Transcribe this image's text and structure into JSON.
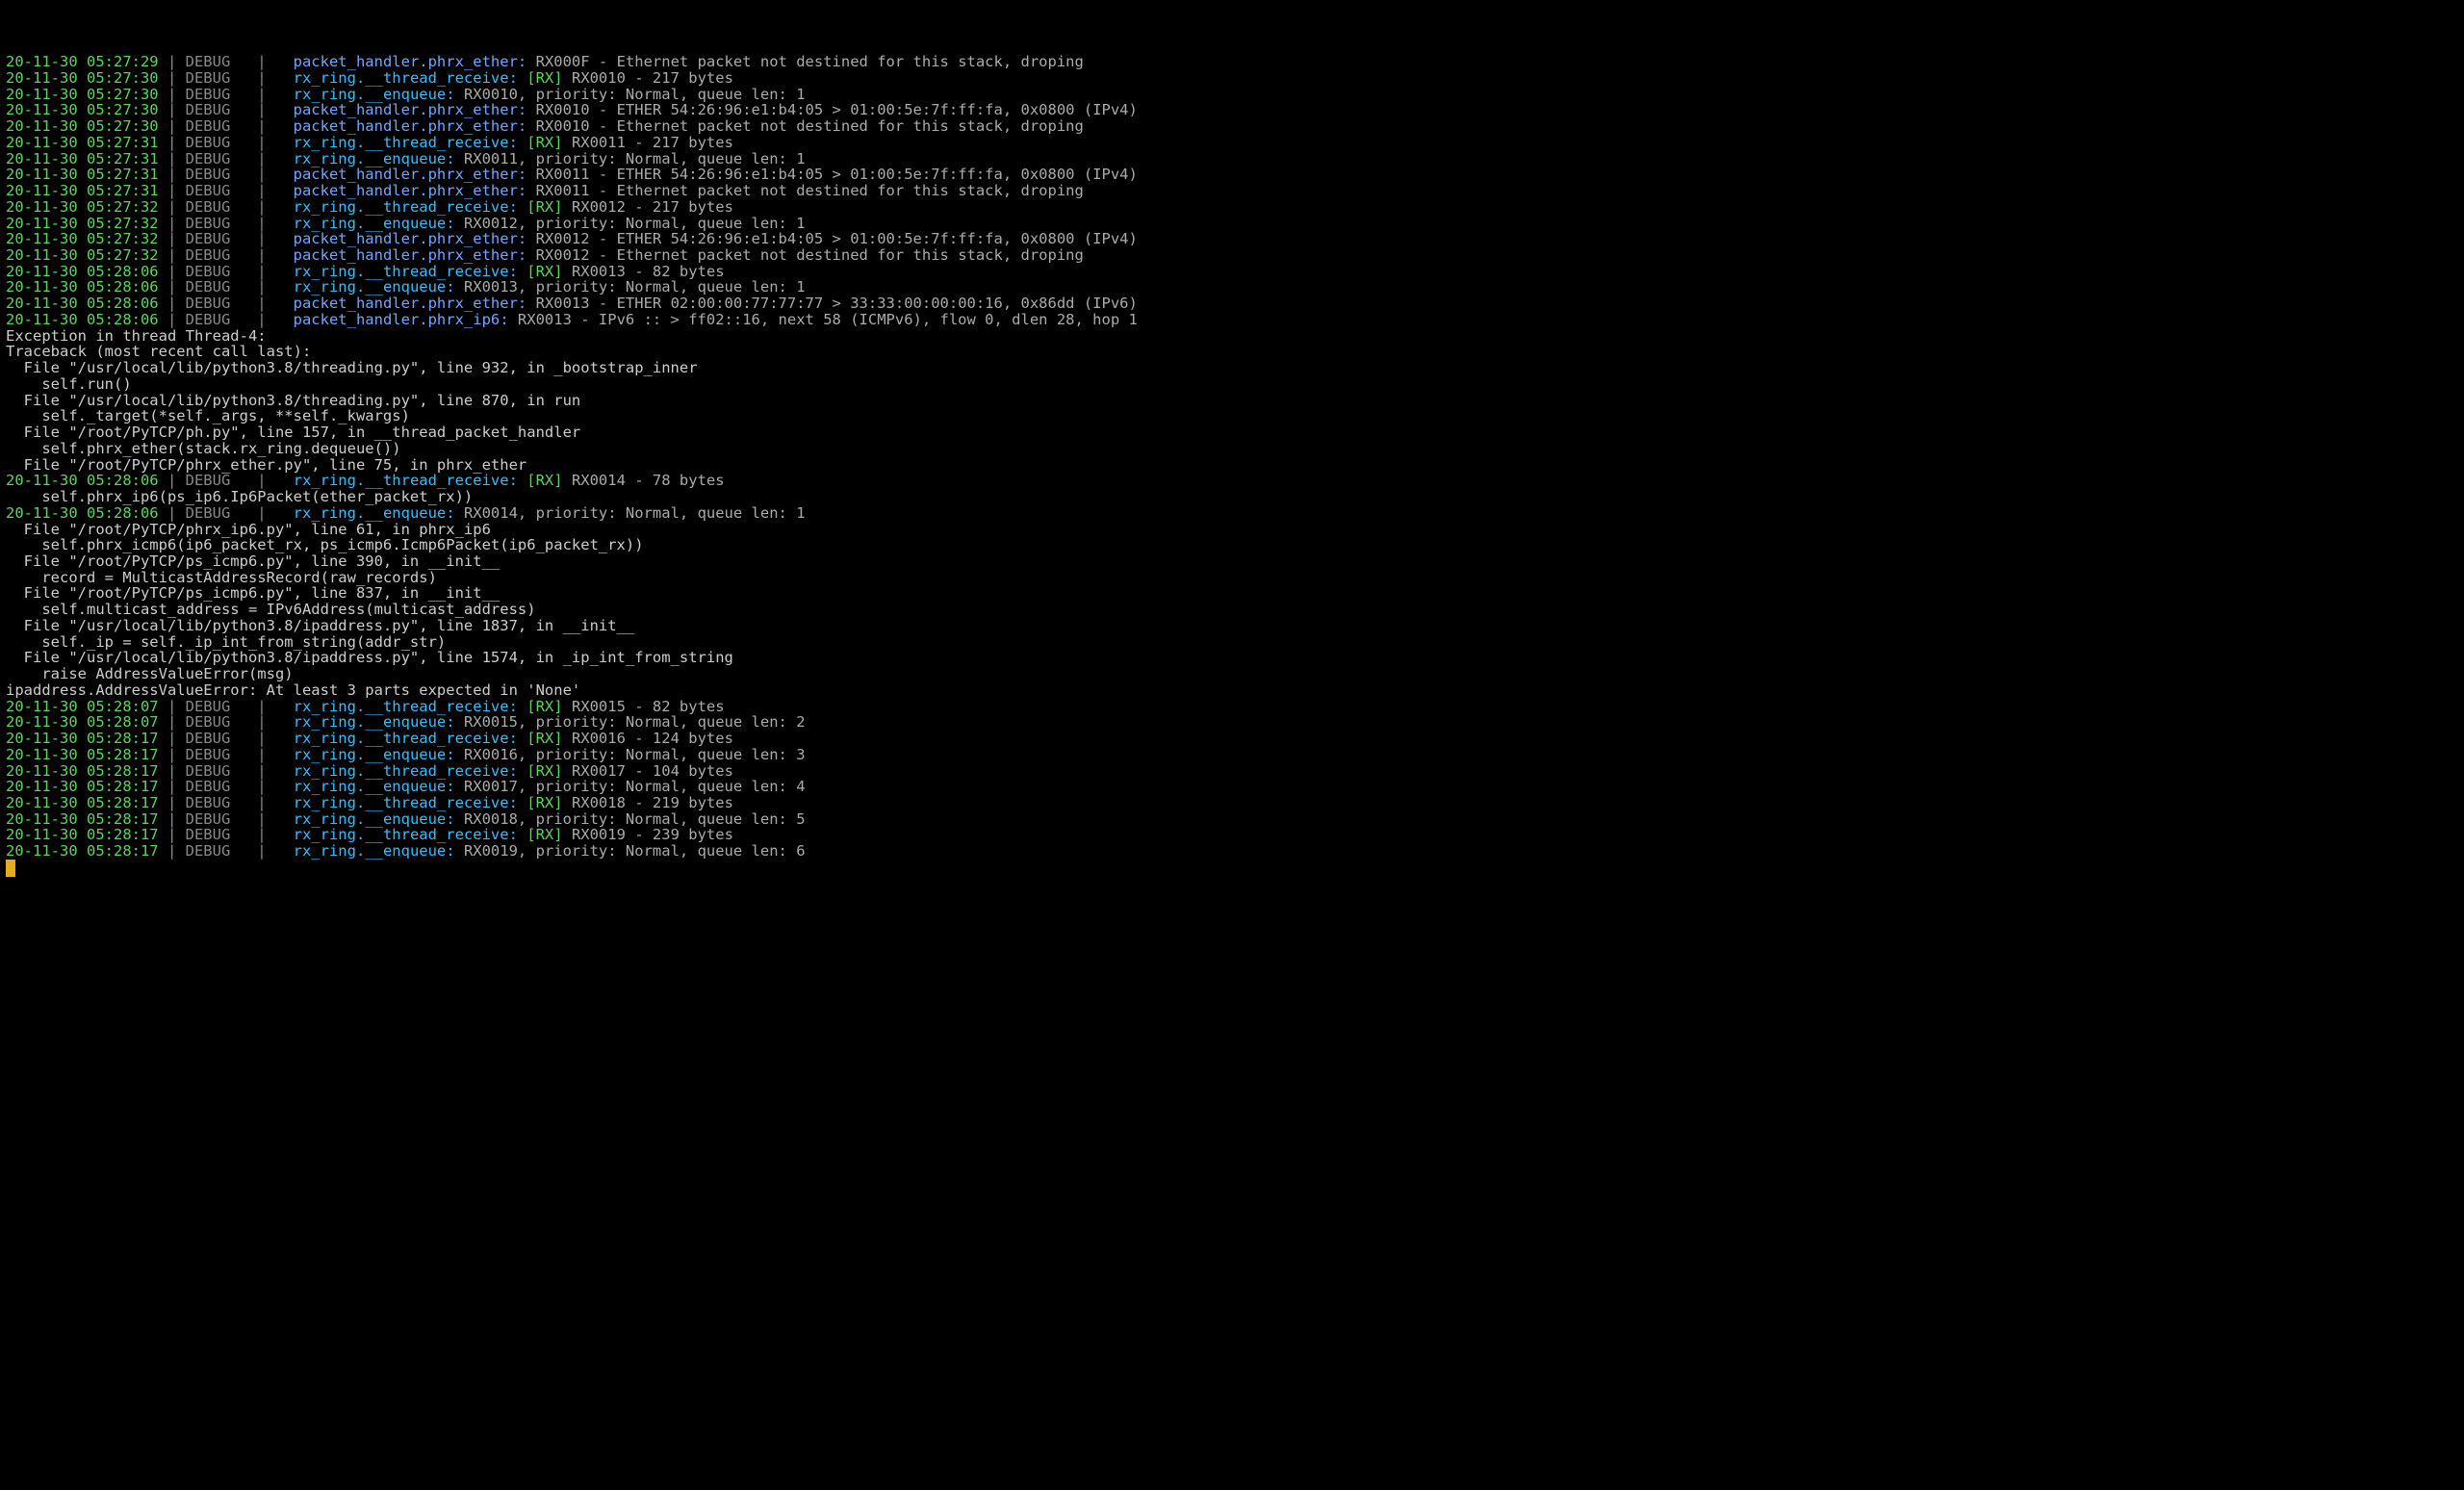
{
  "lines": [
    {
      "type": "log",
      "ts": "20-11-30 05:27:29",
      "lvl": "DEBUG",
      "mod": "packet_handler.phrx_ether:",
      "modClass": "pmod",
      "rx": "",
      "msg": "RX000F - Ethernet packet not destined for this stack, droping"
    },
    {
      "type": "log",
      "ts": "20-11-30 05:27:30",
      "lvl": "DEBUG",
      "mod": "rx_ring.__thread_receive:",
      "modClass": "mod",
      "rx": "[RX] ",
      "msg": "RX0010 - 217 bytes"
    },
    {
      "type": "log",
      "ts": "20-11-30 05:27:30",
      "lvl": "DEBUG",
      "mod": "rx_ring.__enqueue:",
      "modClass": "mod",
      "rx": "",
      "msg": "RX0010, priority: Normal, queue len: 1"
    },
    {
      "type": "log",
      "ts": "20-11-30 05:27:30",
      "lvl": "DEBUG",
      "mod": "packet_handler.phrx_ether:",
      "modClass": "pmod",
      "rx": "",
      "msg": "RX0010 - ETHER 54:26:96:e1:b4:05 > 01:00:5e:7f:ff:fa, 0x0800 (IPv4)"
    },
    {
      "type": "log",
      "ts": "20-11-30 05:27:30",
      "lvl": "DEBUG",
      "mod": "packet_handler.phrx_ether:",
      "modClass": "pmod",
      "rx": "",
      "msg": "RX0010 - Ethernet packet not destined for this stack, droping"
    },
    {
      "type": "log",
      "ts": "20-11-30 05:27:31",
      "lvl": "DEBUG",
      "mod": "rx_ring.__thread_receive:",
      "modClass": "mod",
      "rx": "[RX] ",
      "msg": "RX0011 - 217 bytes"
    },
    {
      "type": "log",
      "ts": "20-11-30 05:27:31",
      "lvl": "DEBUG",
      "mod": "rx_ring.__enqueue:",
      "modClass": "mod",
      "rx": "",
      "msg": "RX0011, priority: Normal, queue len: 1"
    },
    {
      "type": "log",
      "ts": "20-11-30 05:27:31",
      "lvl": "DEBUG",
      "mod": "packet_handler.phrx_ether:",
      "modClass": "pmod",
      "rx": "",
      "msg": "RX0011 - ETHER 54:26:96:e1:b4:05 > 01:00:5e:7f:ff:fa, 0x0800 (IPv4)"
    },
    {
      "type": "log",
      "ts": "20-11-30 05:27:31",
      "lvl": "DEBUG",
      "mod": "packet_handler.phrx_ether:",
      "modClass": "pmod",
      "rx": "",
      "msg": "RX0011 - Ethernet packet not destined for this stack, droping"
    },
    {
      "type": "log",
      "ts": "20-11-30 05:27:32",
      "lvl": "DEBUG",
      "mod": "rx_ring.__thread_receive:",
      "modClass": "mod",
      "rx": "[RX] ",
      "msg": "RX0012 - 217 bytes"
    },
    {
      "type": "log",
      "ts": "20-11-30 05:27:32",
      "lvl": "DEBUG",
      "mod": "rx_ring.__enqueue:",
      "modClass": "mod",
      "rx": "",
      "msg": "RX0012, priority: Normal, queue len: 1"
    },
    {
      "type": "log",
      "ts": "20-11-30 05:27:32",
      "lvl": "DEBUG",
      "mod": "packet_handler.phrx_ether:",
      "modClass": "pmod",
      "rx": "",
      "msg": "RX0012 - ETHER 54:26:96:e1:b4:05 > 01:00:5e:7f:ff:fa, 0x0800 (IPv4)"
    },
    {
      "type": "log",
      "ts": "20-11-30 05:27:32",
      "lvl": "DEBUG",
      "mod": "packet_handler.phrx_ether:",
      "modClass": "pmod",
      "rx": "",
      "msg": "RX0012 - Ethernet packet not destined for this stack, droping"
    },
    {
      "type": "log",
      "ts": "20-11-30 05:28:06",
      "lvl": "DEBUG",
      "mod": "rx_ring.__thread_receive:",
      "modClass": "mod",
      "rx": "[RX] ",
      "msg": "RX0013 - 82 bytes"
    },
    {
      "type": "log",
      "ts": "20-11-30 05:28:06",
      "lvl": "DEBUG",
      "mod": "rx_ring.__enqueue:",
      "modClass": "mod",
      "rx": "",
      "msg": "RX0013, priority: Normal, queue len: 1"
    },
    {
      "type": "log",
      "ts": "20-11-30 05:28:06",
      "lvl": "DEBUG",
      "mod": "packet_handler.phrx_ether:",
      "modClass": "pmod",
      "rx": "",
      "msg": "RX0013 - ETHER 02:00:00:77:77:77 > 33:33:00:00:00:16, 0x86dd (IPv6)"
    },
    {
      "type": "log",
      "ts": "20-11-30 05:28:06",
      "lvl": "DEBUG",
      "mod": "packet_handler.phrx_ip6:",
      "modClass": "pmod",
      "rx": "",
      "msg": "RX0013 - IPv6 :: > ff02::16, next 58 (ICMPv6), flow 0, dlen 28, hop 1"
    },
    {
      "type": "trace",
      "text": "Exception in thread Thread-4:"
    },
    {
      "type": "trace",
      "text": "Traceback (most recent call last):"
    },
    {
      "type": "trace",
      "text": "  File \"/usr/local/lib/python3.8/threading.py\", line 932, in _bootstrap_inner"
    },
    {
      "type": "trace",
      "text": "    self.run()"
    },
    {
      "type": "trace",
      "text": "  File \"/usr/local/lib/python3.8/threading.py\", line 870, in run"
    },
    {
      "type": "trace",
      "text": "    self._target(*self._args, **self._kwargs)"
    },
    {
      "type": "trace",
      "text": "  File \"/root/PyTCP/ph.py\", line 157, in __thread_packet_handler"
    },
    {
      "type": "trace",
      "text": "    self.phrx_ether(stack.rx_ring.dequeue())"
    },
    {
      "type": "trace",
      "text": "  File \"/root/PyTCP/phrx_ether.py\", line 75, in phrx_ether"
    },
    {
      "type": "log",
      "ts": "20-11-30 05:28:06",
      "lvl": "DEBUG",
      "mod": "rx_ring.__thread_receive:",
      "modClass": "mod",
      "rx": "[RX] ",
      "msg": "RX0014 - 78 bytes"
    },
    {
      "type": "trace",
      "text": "    self.phrx_ip6(ps_ip6.Ip6Packet(ether_packet_rx))"
    },
    {
      "type": "log",
      "ts": "20-11-30 05:28:06",
      "lvl": "DEBUG",
      "mod": "rx_ring.__enqueue:",
      "modClass": "mod",
      "rx": "",
      "msg": "RX0014, priority: Normal, queue len: 1"
    },
    {
      "type": "trace",
      "text": "  File \"/root/PyTCP/phrx_ip6.py\", line 61, in phrx_ip6"
    },
    {
      "type": "trace",
      "text": "    self.phrx_icmp6(ip6_packet_rx, ps_icmp6.Icmp6Packet(ip6_packet_rx))"
    },
    {
      "type": "trace",
      "text": "  File \"/root/PyTCP/ps_icmp6.py\", line 390, in __init__"
    },
    {
      "type": "trace",
      "text": "    record = MulticastAddressRecord(raw_records)"
    },
    {
      "type": "trace",
      "text": "  File \"/root/PyTCP/ps_icmp6.py\", line 837, in __init__"
    },
    {
      "type": "trace",
      "text": "    self.multicast_address = IPv6Address(multicast_address)"
    },
    {
      "type": "trace",
      "text": "  File \"/usr/local/lib/python3.8/ipaddress.py\", line 1837, in __init__"
    },
    {
      "type": "trace",
      "text": "    self._ip = self._ip_int_from_string(addr_str)"
    },
    {
      "type": "trace",
      "text": "  File \"/usr/local/lib/python3.8/ipaddress.py\", line 1574, in _ip_int_from_string"
    },
    {
      "type": "trace",
      "text": "    raise AddressValueError(msg)"
    },
    {
      "type": "trace",
      "text": "ipaddress.AddressValueError: At least 3 parts expected in 'None'"
    },
    {
      "type": "log",
      "ts": "20-11-30 05:28:07",
      "lvl": "DEBUG",
      "mod": "rx_ring.__thread_receive:",
      "modClass": "mod",
      "rx": "[RX] ",
      "msg": "RX0015 - 82 bytes"
    },
    {
      "type": "log",
      "ts": "20-11-30 05:28:07",
      "lvl": "DEBUG",
      "mod": "rx_ring.__enqueue:",
      "modClass": "mod",
      "rx": "",
      "msg": "RX0015, priority: Normal, queue len: 2"
    },
    {
      "type": "log",
      "ts": "20-11-30 05:28:17",
      "lvl": "DEBUG",
      "mod": "rx_ring.__thread_receive:",
      "modClass": "mod",
      "rx": "[RX] ",
      "msg": "RX0016 - 124 bytes"
    },
    {
      "type": "log",
      "ts": "20-11-30 05:28:17",
      "lvl": "DEBUG",
      "mod": "rx_ring.__enqueue:",
      "modClass": "mod",
      "rx": "",
      "msg": "RX0016, priority: Normal, queue len: 3"
    },
    {
      "type": "log",
      "ts": "20-11-30 05:28:17",
      "lvl": "DEBUG",
      "mod": "rx_ring.__thread_receive:",
      "modClass": "mod",
      "rx": "[RX] ",
      "msg": "RX0017 - 104 bytes"
    },
    {
      "type": "log",
      "ts": "20-11-30 05:28:17",
      "lvl": "DEBUG",
      "mod": "rx_ring.__enqueue:",
      "modClass": "mod",
      "rx": "",
      "msg": "RX0017, priority: Normal, queue len: 4"
    },
    {
      "type": "log",
      "ts": "20-11-30 05:28:17",
      "lvl": "DEBUG",
      "mod": "rx_ring.__thread_receive:",
      "modClass": "mod",
      "rx": "[RX] ",
      "msg": "RX0018 - 219 bytes"
    },
    {
      "type": "log",
      "ts": "20-11-30 05:28:17",
      "lvl": "DEBUG",
      "mod": "rx_ring.__enqueue:",
      "modClass": "mod",
      "rx": "",
      "msg": "RX0018, priority: Normal, queue len: 5"
    },
    {
      "type": "log",
      "ts": "20-11-30 05:28:17",
      "lvl": "DEBUG",
      "mod": "rx_ring.__thread_receive:",
      "modClass": "mod",
      "rx": "[RX] ",
      "msg": "RX0019 - 239 bytes"
    },
    {
      "type": "log",
      "ts": "20-11-30 05:28:17",
      "lvl": "DEBUG",
      "mod": "rx_ring.__enqueue:",
      "modClass": "mod",
      "rx": "",
      "msg": "RX0019, priority: Normal, queue len: 6"
    }
  ]
}
